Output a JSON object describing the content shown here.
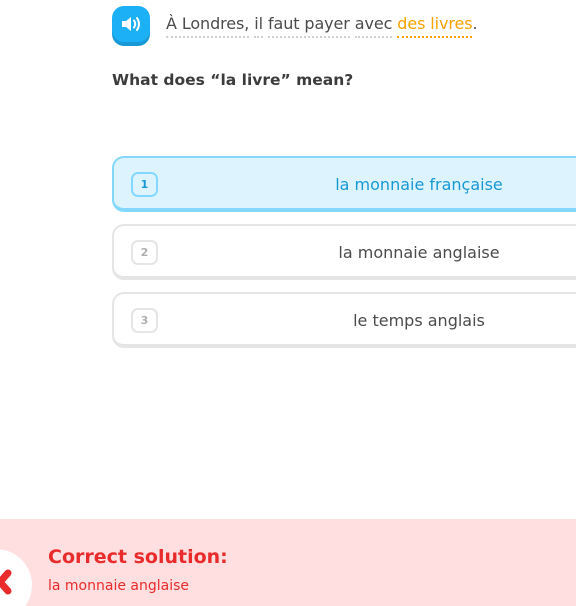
{
  "prompt": {
    "audio_icon": "speaker-icon",
    "sentence_parts": [
      {
        "text": "À Londres,",
        "new": false
      },
      {
        "text": "il",
        "new": false
      },
      {
        "text": "faut payer",
        "new": false
      },
      {
        "text": "avec",
        "new": false
      },
      {
        "text": "des livres",
        "new": true
      },
      {
        "text": ".",
        "plain": true
      }
    ]
  },
  "question": "What does “la livre” mean?",
  "options": [
    {
      "number": "1",
      "label": "la monnaie française",
      "selected": true
    },
    {
      "number": "2",
      "label": "la monnaie anglaise",
      "selected": false
    },
    {
      "number": "3",
      "label": "le temps anglais",
      "selected": false
    }
  ],
  "feedback": {
    "title": "Correct solution:",
    "answer": "la monnaie anglaise",
    "icon": "wrong-x-icon"
  },
  "colors": {
    "accent_blue": "#1cb0f6",
    "new_word": "#f7a200",
    "error_red": "#ea2b2b",
    "error_bg": "#ffdfe0",
    "selected_bg": "#ddf4ff"
  }
}
